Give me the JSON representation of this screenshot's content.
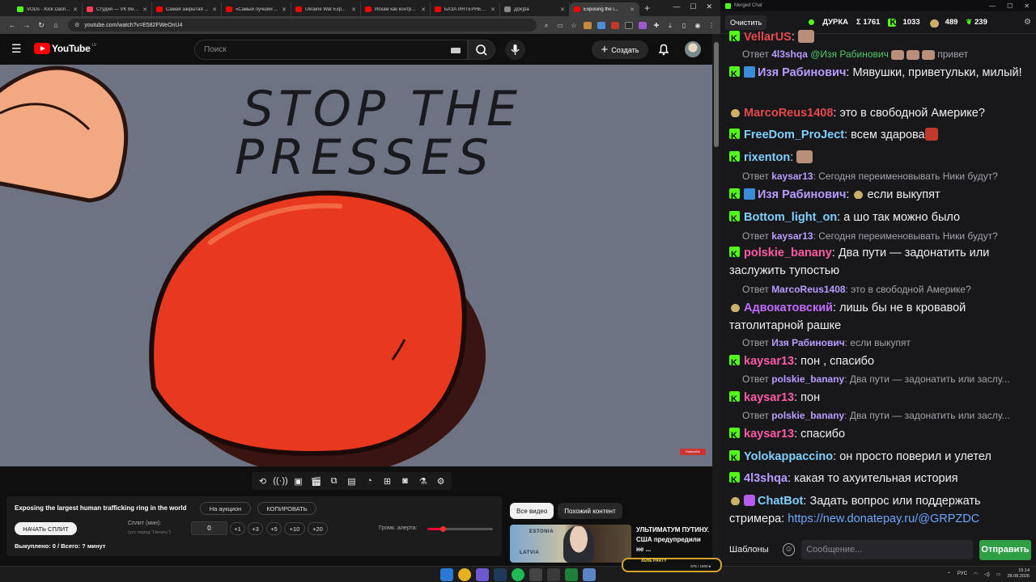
{
  "browser": {
    "tabs": [
      {
        "title": "VODs - Kick Dash...",
        "color": "#53fc18",
        "active": false
      },
      {
        "title": "Студия — VK Виде...",
        "color": "#ff3b5c",
        "active": false
      },
      {
        "title": "Самая закрытая ...",
        "color": "#ff0000",
        "active": false
      },
      {
        "title": "«Самый лучший ...",
        "color": "#ff0000",
        "active": false
      },
      {
        "title": "Ukraine War Exp...",
        "color": "#ff0000",
        "active": false
      },
      {
        "title": "Искам как контр...",
        "color": "#ff0000",
        "active": false
      },
      {
        "title": "БАЗА ИНТЕРНЕТ ...",
        "color": "#ff0000",
        "active": false
      },
      {
        "title": "Д(ж)ра",
        "color": "#888888",
        "active": false
      },
      {
        "title": "Exposing the l...",
        "color": "#ff0000",
        "active": true
      }
    ],
    "url": "youtube.com/watch?v=E582FWeOnU4"
  },
  "youtube": {
    "logo_text": "YouTube",
    "region": "LV",
    "search_placeholder": "Поиск",
    "create_label": "Создать"
  },
  "video": {
    "headline_line1": "STOP THE",
    "headline_line2": "PRESSES",
    "watermark": "Subscribe"
  },
  "auction": {
    "title": "Exposing the largest human trafficking ring in the world",
    "auction_btn": "На аукцион",
    "copy_btn": "КОПИРОВАТЬ",
    "split_btn": "НАЧАТЬ СПЛИТ",
    "split_label": "Сплит (мин):",
    "split_hint": "(уст. перед \"Начать\")",
    "split_value": "0",
    "increments": [
      "+1",
      "+3",
      "+5",
      "+10",
      "+20"
    ],
    "sold_text": "Выкуплено: 0 / Всего: ? минут",
    "volume_label": "Громк. алерта:",
    "volume_fraction": 0.23
  },
  "recommended": {
    "tab_all": "Все видео",
    "tab_similar": "Похожий контент",
    "thumb_label_top": "ESTONIA",
    "thumb_label_bottom": "LATVIA",
    "title": "УЛЬТИМАТУМ ПУТИНУ. США предупредили не ..."
  },
  "chat": {
    "window_title": "Merged Chat",
    "clear_label": "Очистить",
    "channel": "ДУРКА",
    "stat_total": "Σ 1761",
    "stat_kick": "1033",
    "stat_a": "489",
    "stat_b": "239",
    "reply_prefix": "Ответ",
    "templates_label": "Шаблоны",
    "input_placeholder": "Сообщение...",
    "send_label": "Отправить",
    "messages": [
      {
        "user": "VellarUS",
        "color": "#e5484d",
        "text": ":",
        "emote": true
      },
      {
        "user": "Изя Рабинович",
        "color": "#b89cff",
        "text": "Мявушки, приветульки, милый!"
      },
      {
        "user": "MarcoReus1408",
        "color": "#e5484d",
        "text": "это в свободной Америке?"
      },
      {
        "user": "FreeDom_ProJect",
        "color": "#7fd0ff",
        "text": "всем здарова"
      },
      {
        "user": "rixenton",
        "color": "#7fd0ff",
        "text": ""
      },
      {
        "user": "Изя Рабинович",
        "color": "#b89cff",
        "text": "если выкупят"
      },
      {
        "user": "Bottom_light_on",
        "color": "#7fd0ff",
        "text": "а шо так можно было"
      },
      {
        "user": "polskie_banany",
        "color": "#ff5aa5",
        "text": "Два пути — задонатить или заслужить тупостью"
      },
      {
        "user": "Адвокатовский",
        "color": "#c46bff",
        "text": "лишь бы не в кровавой татолитарной рашке"
      },
      {
        "user": "kaysar13",
        "color": "#ff5aa5",
        "text": "пон , спасибо"
      },
      {
        "user": "kaysar13",
        "color": "#ff5aa5",
        "text": "пон"
      },
      {
        "user": "kaysar13",
        "color": "#ff5aa5",
        "text": "спасибо"
      },
      {
        "user": "Yolokappaccino",
        "color": "#7fd0ff",
        "text": "он просто поверил и улетел"
      },
      {
        "user": "4l3shqa",
        "color": "#b89cff",
        "text": "какая то ахуительная история"
      },
      {
        "user": "ChatBot",
        "color": "#7fd0ff",
        "text": "Задать вопрос или поддержать стримера:",
        "link": "https://new.donatepay.ru/@GRPZDC"
      }
    ],
    "replies": [
      {
        "user": "4l3shqa",
        "text": "@Изя Рабинович",
        "tail": "привет"
      },
      {
        "user": "kaysar13",
        "text": "Сегодня переименовывать Ники будут?"
      },
      {
        "user": "kaysar13",
        "text": "Сегодня переименовывать Ники будут?"
      },
      {
        "user": "MarcoReus1408",
        "text": "это в свободной Америке?"
      },
      {
        "user": "Изя Рабинович",
        "text": "если выкупят"
      },
      {
        "user": "polskie_banany",
        "text": "Два пути — задонатить или заслу..."
      },
      {
        "user": "polskie_banany",
        "text": "Два пути — задонатить или заслу..."
      }
    ]
  },
  "taskbar": {
    "overlay_label": "ХЕНЕ PARTY",
    "overlay_value": "875 / 1500 ⏺",
    "lang": "РУС",
    "time": "15:14",
    "date": "28.08.2026"
  }
}
